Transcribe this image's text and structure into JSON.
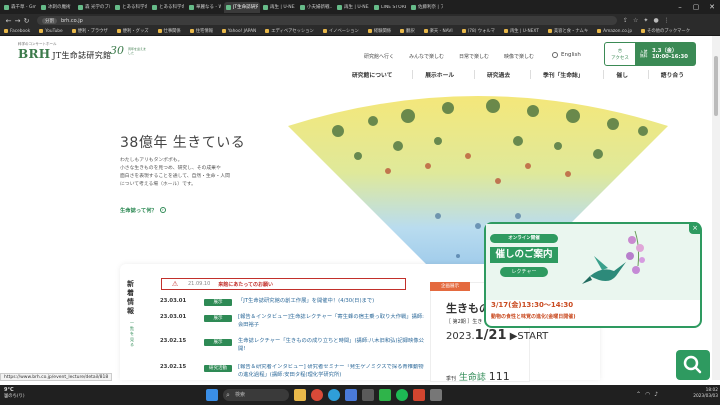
{
  "browser": {
    "tabs": [
      {
        "title": "森千草 - Gmail"
      },
      {
        "title": "冰刺の魔術"
      },
      {
        "title": "森 光学のブログ"
      },
      {
        "title": "とある科学の超電磁"
      },
      {
        "title": "とある科学の超電磁"
      },
      {
        "title": "華麗なる - Wiki"
      },
      {
        "title": "JT生命誌研究館",
        "active": true
      },
      {
        "title": "再生 | U-NEXT"
      },
      {
        "title": "小夫婦新戦…"
      },
      {
        "title": "再生 | U-NEXT"
      },
      {
        "title": "LINE STORE - LI"
      },
      {
        "title": "佐藤利奈 | アニ"
      }
    ],
    "url": "brh.co.jp",
    "url_badge": "分割",
    "bookmarks": [
      "Facebook",
      "YouTube",
      "便利・ブラウザ",
      "便利・グッズ",
      "仕事関係",
      "住宅情報",
      "Yahoo! JAPAN",
      "エディベアセッション",
      "イノベーション",
      "経験関係",
      "翻訳",
      "楽天 - NAVI",
      "(78) ウォルマ",
      "再生 | U-NEXT",
      "美容と食・ナムキ",
      "Amazon.co.jp",
      "その他のブックマーク"
    ]
  },
  "header": {
    "tagline": "科学のコンサートホール",
    "logo_brh": "BRH",
    "logo_name": "JT生命誌研究館",
    "anniv_num": "30",
    "anniv_text": "周年を迎えました",
    "top_links": [
      "研究館へ行く",
      "みんなで楽しむ",
      "日常で楽しむ",
      "映像で楽しむ"
    ],
    "lang": "English",
    "access": "アクセス",
    "hours_label": "入館無料",
    "hours_days": "3.3（金）",
    "hours_time": "10:00-16:30"
  },
  "nav": [
    "研究館について",
    "展示ホール",
    "研究過去",
    "季刊「生命誌」",
    "催し",
    "語り合う"
  ],
  "hero": {
    "title": "38億年 生きている",
    "desc_lines": [
      "わたしもアリもタンポポも。",
      "小さな生きものを見つめ、研究し、その成果や",
      "面白さを表現することを通して、自然・生命・人間",
      "について考える場（ホール）です。"
    ],
    "link": "生命誌って何？"
  },
  "news": {
    "heading": "新着情報",
    "more": "一覧を見る",
    "alert_date": "21.09.10",
    "alert_text": "来館にあたってのお願い",
    "items": [
      {
        "date": "23.03.01",
        "tag": "展示",
        "text": "「JT生命誌研究館の創工作展」を開催中！(4/30(日)まで)"
      },
      {
        "date": "23.03.01",
        "tag": "展示",
        "text": "[報告＆インタビュー]生命誌レクチャー「寄生蜂の宿主乗っ取り大作戦」講師:会田裕子"
      },
      {
        "date": "23.02.15",
        "tag": "展示",
        "text": "生命誌レクチャー「生きものの成り立ちと時間」(講師:八木旧和弘)記録映像公開!"
      },
      {
        "date": "23.02.15",
        "tag": "研究活動",
        "text": "[報告＆研究者インタビュー] 研究者セミナー「発生ゲノミクスで探る脊椎動物の進化過程」(講師:安田タ程(理化学研究所)"
      }
    ]
  },
  "event": {
    "tag": "企画展示",
    "title": "生きもの",
    "sub": "［ 第2期 ］生き",
    "year": "2023.",
    "date": "1/21",
    "start": "START",
    "kikan_label": "季刊",
    "kikan_title": "生命誌",
    "kikan_num": "111"
  },
  "popup": {
    "badge": "オンライン開催",
    "title": "催しのご案内",
    "button": "レクチャー",
    "date": "3/17(金)13:30〜14:30",
    "desc": "動物の食性と味覚の進化(金曜日開催)",
    "close": "×"
  },
  "status_url": "https://www.brh.co.jp/event_lecture/detail/818",
  "taskbar": {
    "temp": "9°C",
    "weather": "曇のち(り)",
    "search": "検索",
    "time": "18:02",
    "date": "2023/03/03"
  }
}
